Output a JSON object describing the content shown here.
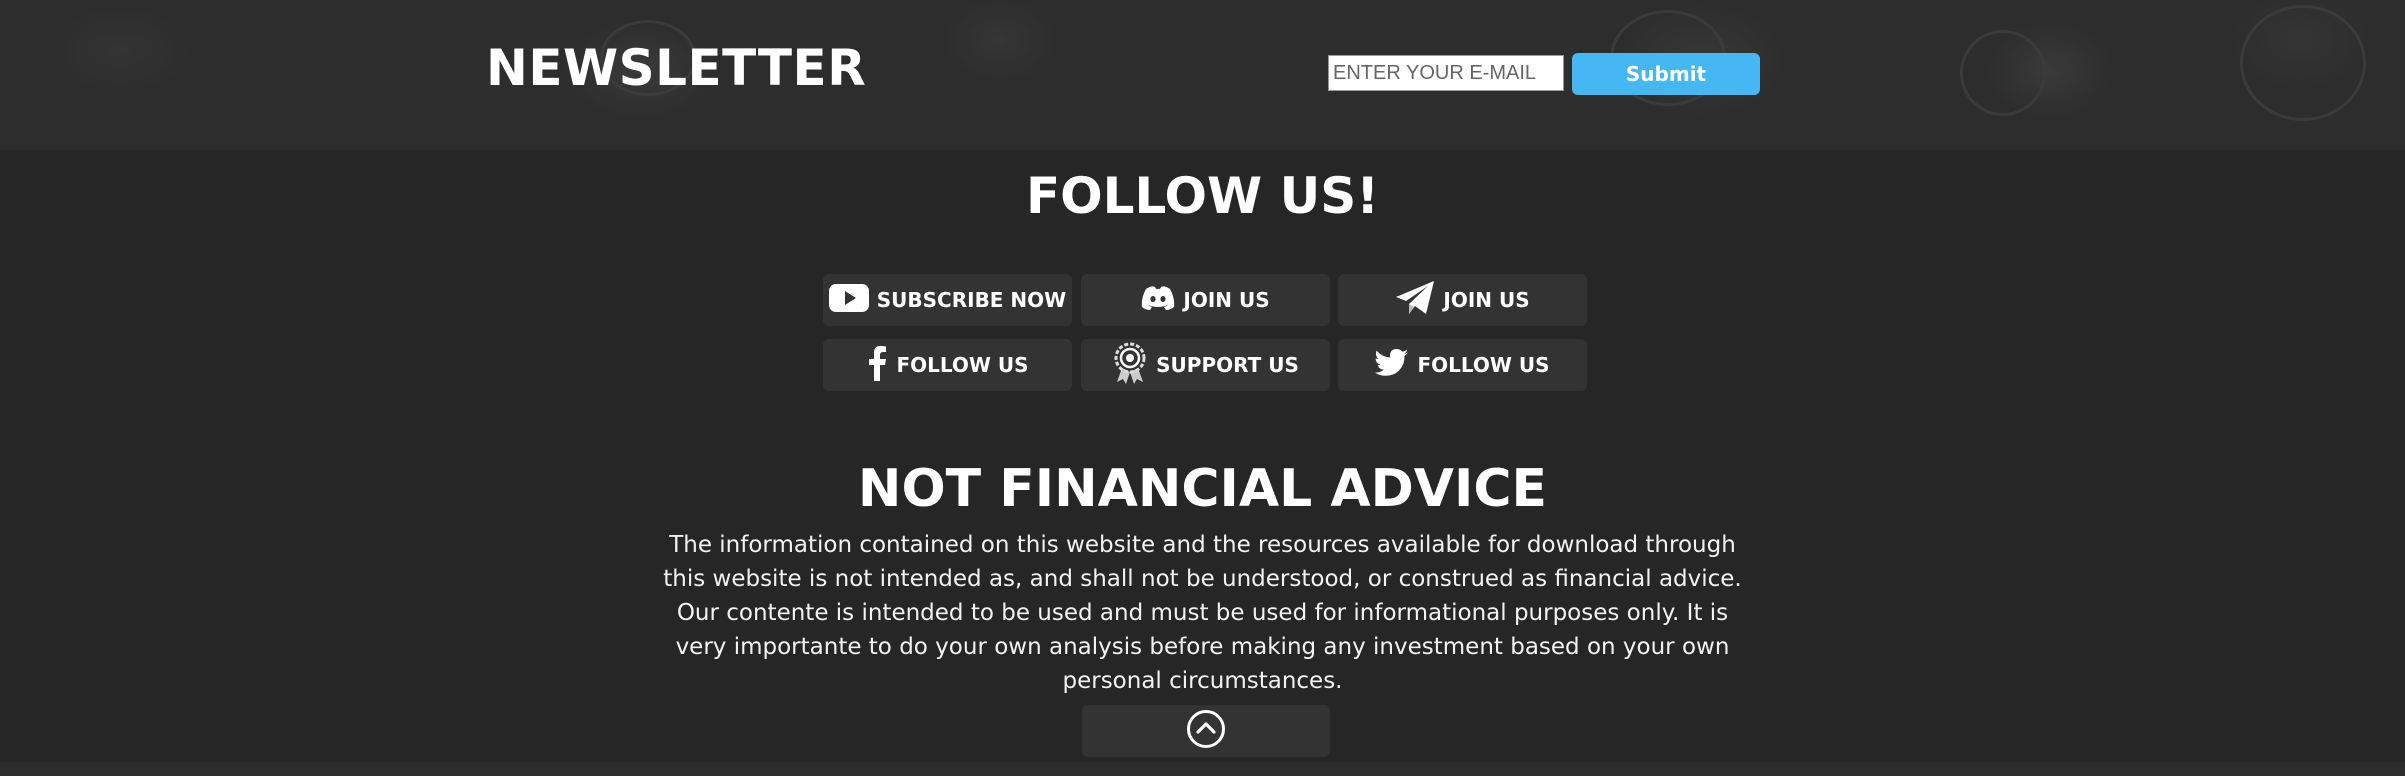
{
  "newsletter": {
    "title": "NEWSLETTER",
    "email_placeholder": "ENTER YOUR E-MAIL",
    "submit_label": "Submit"
  },
  "follow": {
    "title": "FOLLOW US!",
    "buttons": [
      {
        "label": "SUBSCRIBE NOW",
        "icon": "youtube-icon"
      },
      {
        "label": "JOIN US",
        "icon": "discord-icon"
      },
      {
        "label": "JOIN US",
        "icon": "telegram-icon"
      },
      {
        "label": "FOLLOW US",
        "icon": "facebook-icon"
      },
      {
        "label": "SUPPORT US",
        "icon": "award-badge-icon"
      },
      {
        "label": "FOLLOW US",
        "icon": "twitter-icon"
      }
    ]
  },
  "disclaimer": {
    "title": "NOT FINANCIAL ADVICE",
    "text": "The information contained on this website and the resources available for download through this website is not intended as, and shall not be understood, or construed as financial advice. Our contente is intended to be used and must be used for informational purposes only. It is very importante to do your own analysis before making any investment based on your own personal circumstances."
  },
  "scroll_top": {
    "icon": "chevron-up-circle-icon"
  },
  "colors": {
    "background": "#262626",
    "newsletter_band": "#2d2d2d",
    "button_bg": "#333333",
    "submit_accent": "#45b8f3",
    "text": "#ffffff"
  }
}
